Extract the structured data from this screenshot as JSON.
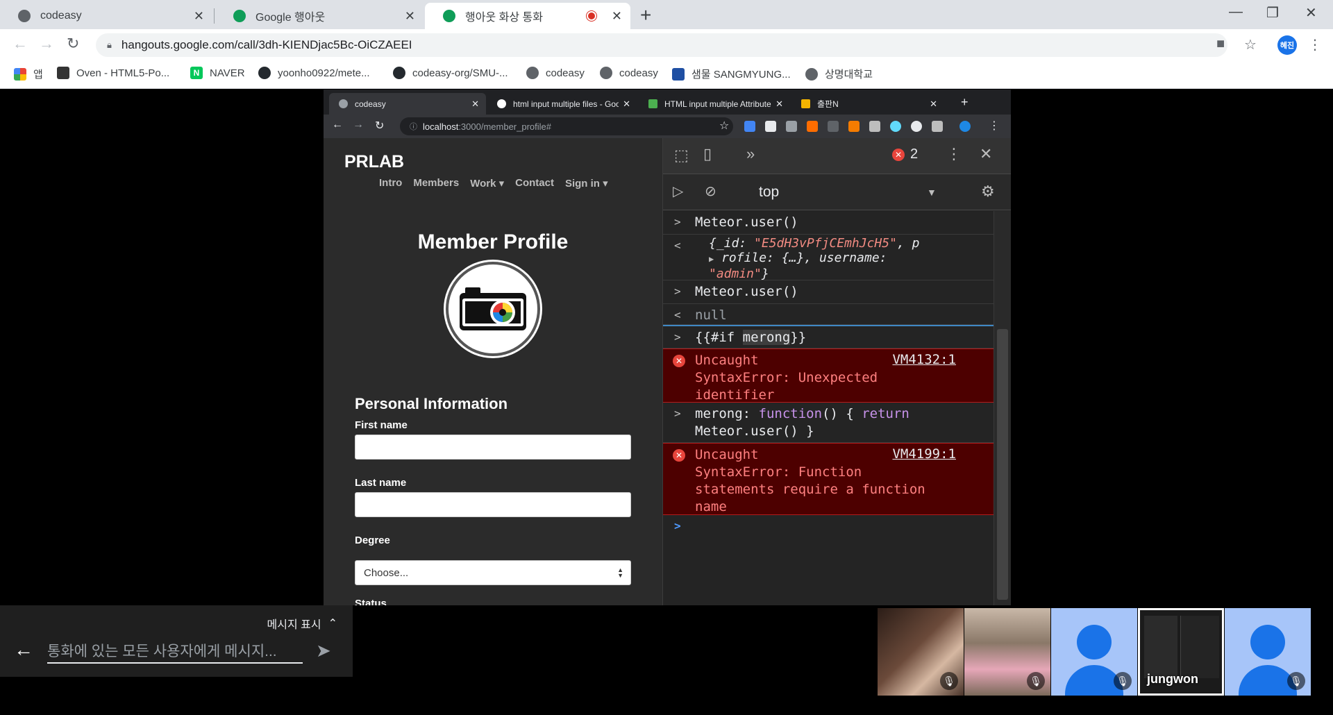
{
  "browser": {
    "tabs": [
      {
        "title": "codeasy",
        "color": "#5f6368"
      },
      {
        "title": "Google 행아웃",
        "color": "#0f9d58"
      },
      {
        "title": "행아웃 화상 통화",
        "color": "#0f9d58"
      }
    ],
    "address": "hangouts.google.com/call/3dh-KIENDjac5Bc-OiCZAEEI",
    "profile_initials": "혜진",
    "bookmarks": [
      {
        "label": "앱",
        "icon": "apps-grid-icon"
      },
      {
        "label": "Oven - HTML5-Po...",
        "icon": "oven-icon"
      },
      {
        "label": "NAVER",
        "icon": "naver-icon"
      },
      {
        "label": "yoonho0922/mete...",
        "icon": "github-icon"
      },
      {
        "label": "codeasy-org/SMU-...",
        "icon": "github-icon"
      },
      {
        "label": "codeasy",
        "icon": "globe-icon"
      },
      {
        "label": "codeasy",
        "icon": "globe-icon"
      },
      {
        "label": "샘물 SANGMYUNG...",
        "icon": "smu-icon"
      },
      {
        "label": "상명대학교",
        "icon": "globe-icon"
      }
    ]
  },
  "shared_screen": {
    "tabs": [
      {
        "title": "codeasy"
      },
      {
        "title": "html input multiple files - Googl"
      },
      {
        "title": "HTML input multiple Attribute"
      },
      {
        "title": "출판N"
      }
    ],
    "address_host": "localhost",
    "address_path": ":3000/member_profile#",
    "webpage": {
      "brand": "PRLAB",
      "nav": [
        "Intro",
        "Members",
        "Work ▾",
        "Contact",
        "Sign in ▾"
      ],
      "title": "Member Profile",
      "section": "Personal Information",
      "fields": {
        "first_name": "First name",
        "last_name": "Last name",
        "degree": "Degree",
        "degree_value": "Choose...",
        "status": "Status"
      }
    },
    "devtools": {
      "error_count": "2",
      "context": "top",
      "console": {
        "cmd1": "Meteor.user()",
        "res1_a": "{_id: ",
        "res1_id": "\"E5dH3vPfjCEmhJcH5\"",
        "res1_b": ", p",
        "res1_c": "rofile: {…}, username:",
        "res1_user": "\"admin\"",
        "res1_d": "}",
        "cmd2": "Meteor.user()",
        "res2": "null",
        "cmd3_a": "{{#if ",
        "cmd3_b": "merong",
        "cmd3_c": "}}",
        "err1_text": "Uncaught\nSyntaxError: Unexpected\nidentifier",
        "err1_src": "VM4132:1",
        "cmd4_a": "merong: ",
        "cmd4_kw1": "function",
        "cmd4_b": "() { ",
        "cmd4_kw2": "return",
        "cmd4_c": "\nMeteor.user() }",
        "err2_text": "Uncaught\nSyntaxError: Function\nstatements require a function\nname",
        "err2_src": "VM4199:1"
      }
    }
  },
  "hangouts": {
    "message_toggle": "메시지 표시",
    "message_placeholder": "통화에 있는 모든 사용자에게 메시지...",
    "participants": [
      {
        "name": "",
        "kind": "video",
        "color": "#5a4436"
      },
      {
        "name": "",
        "kind": "video",
        "color": "#a08a78"
      },
      {
        "name": "",
        "kind": "avatar"
      },
      {
        "name": "jungwon",
        "kind": "screen"
      },
      {
        "name": "",
        "kind": "avatar"
      }
    ]
  }
}
